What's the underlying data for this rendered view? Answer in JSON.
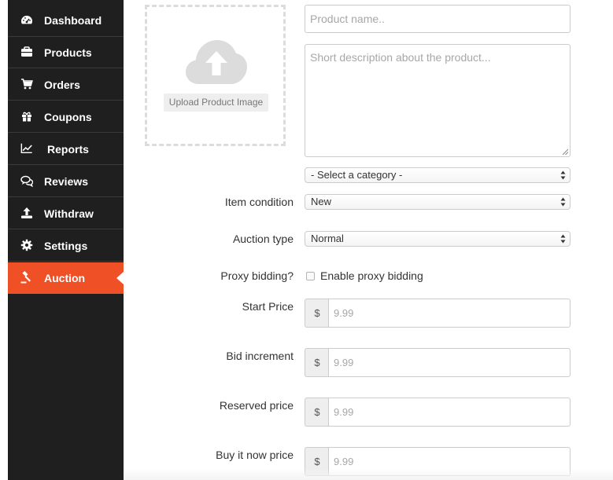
{
  "sidebar": {
    "items": [
      {
        "label": "Dashboard",
        "icon": "dashboard-icon"
      },
      {
        "label": "Products",
        "icon": "briefcase-icon"
      },
      {
        "label": "Orders",
        "icon": "cart-icon"
      },
      {
        "label": "Coupons",
        "icon": "gift-icon"
      },
      {
        "label": "Reports",
        "icon": "line-chart-icon"
      },
      {
        "label": "Reviews",
        "icon": "comments-icon"
      },
      {
        "label": "Withdraw",
        "icon": "upload-icon"
      },
      {
        "label": "Settings",
        "icon": "gear-icon"
      },
      {
        "label": "Auction",
        "icon": "gavel-icon",
        "active": true
      }
    ],
    "accent": "#f05025",
    "background": "#1f1f1f"
  },
  "upload": {
    "button_label": "Upload Product Image",
    "icon": "cloud-upload-icon"
  },
  "form": {
    "product_name_placeholder": "Product name..",
    "description_placeholder": "Short description about the product...",
    "category_value": "- Select a category -",
    "condition_label": "Item condition",
    "condition_value": "New",
    "auction_type_label": "Auction type",
    "auction_type_value": "Normal",
    "proxy_label": "Proxy bidding?",
    "proxy_checkbox_label": "Enable proxy bidding",
    "proxy_checked": false,
    "currency": "$",
    "start_price_label": "Start Price",
    "start_price_placeholder": "9.99",
    "bid_increment_label": "Bid increment",
    "bid_increment_placeholder": "9.99",
    "reserved_price_label": "Reserved price",
    "reserved_price_placeholder": "9.99",
    "buy_now_label": "Buy it now price",
    "buy_now_placeholder": "9.99"
  }
}
